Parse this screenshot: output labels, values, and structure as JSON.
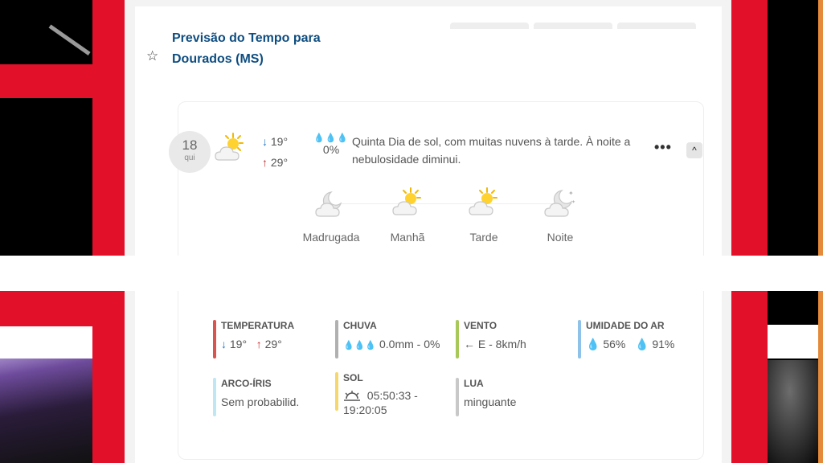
{
  "header": {
    "title": "Previsão do Tempo para Dourados (MS)"
  },
  "forecast": {
    "day_number": "18",
    "day_of_week": "qui",
    "min_temp": "19°",
    "max_temp": "29°",
    "rain_chance": "0%",
    "description": "Quinta Dia de sol, com muitas nuvens à tarde. À noite a nebulosidade diminui.",
    "menu_label": "•••",
    "collapse_label": "^",
    "periods": [
      {
        "label": "Madrugada",
        "icon": "moon-cloud-icon"
      },
      {
        "label": "Manhã",
        "icon": "sun-cloud-icon"
      },
      {
        "label": "Tarde",
        "icon": "sun-cloud-icon"
      },
      {
        "label": "Noite",
        "icon": "moon-stars-cloud-icon"
      }
    ],
    "details": {
      "temperature": {
        "title": "TEMPERATURA",
        "min": "19°",
        "max": "29°",
        "color": "#d9534f"
      },
      "rain": {
        "title": "CHUVA",
        "value": "0.0mm - 0%",
        "color": "#b0b0b0"
      },
      "wind": {
        "title": "VENTO",
        "value": "E - 8km/h",
        "color": "#a8c95a"
      },
      "humidity": {
        "title": "UMIDADE DO AR",
        "min": "56%",
        "max": "91%",
        "color": "#8ec2e8"
      },
      "rainbow": {
        "title": "ARCO-ÍRIS",
        "value": "Sem probabilid.",
        "color": "#bfe6f2"
      },
      "sun": {
        "title": "SOL",
        "value_line1": "05:50:33 -",
        "value_line2": "19:20:05",
        "color": "#f5d76e"
      },
      "moon": {
        "title": "LUA",
        "value": "minguante",
        "color": "#c8c8c8"
      }
    }
  },
  "colors": {
    "accent_red": "#e3102a",
    "title_blue": "#0e4d80"
  }
}
